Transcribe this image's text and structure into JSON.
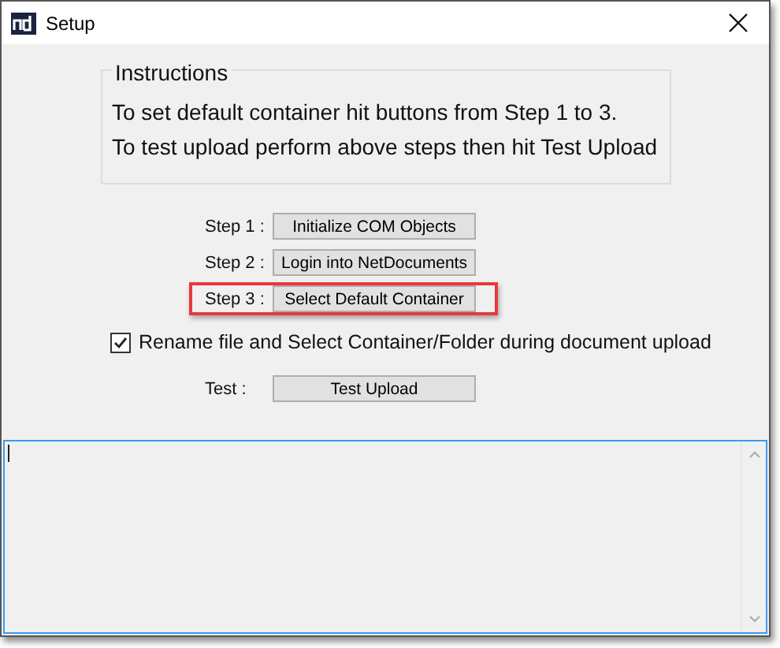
{
  "window": {
    "title": "Setup"
  },
  "instructions": {
    "title": "Instructions",
    "lines": [
      "To set default container hit buttons from Step 1 to 3.",
      "To test upload perform above steps then hit Test Upload"
    ]
  },
  "steps": [
    {
      "label": "Step 1 :",
      "button": "Initialize COM Objects",
      "highlighted": false
    },
    {
      "label": "Step 2 :",
      "button": "Login into NetDocuments",
      "highlighted": false
    },
    {
      "label": "Step 3 :",
      "button": "Select Default Container",
      "highlighted": true
    }
  ],
  "option": {
    "label": "Rename file and Select Container/Folder during document upload",
    "checked": true
  },
  "test": {
    "label": "Test :",
    "button": "Test Upload"
  },
  "log": {
    "focused": true
  }
}
